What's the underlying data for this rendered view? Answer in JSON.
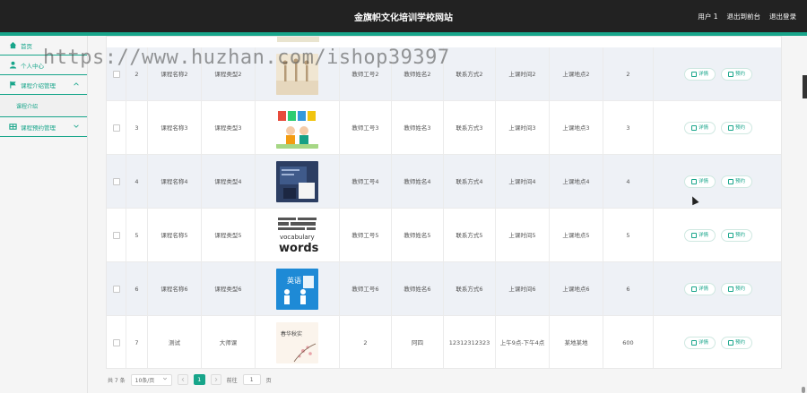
{
  "header": {
    "title": "金旗帜文化培训学校网站",
    "user": "用户 1",
    "back_admin": "退出到前台",
    "logout": "退出登录"
  },
  "sidebar": {
    "items": [
      {
        "label": "首页",
        "icon": "home-icon"
      },
      {
        "label": "个人中心",
        "icon": "user-icon"
      },
      {
        "label": "课程介绍管理",
        "icon": "flag-icon",
        "expandable": true
      },
      {
        "label": "课程介绍",
        "sub": true
      },
      {
        "label": "课程预约管理",
        "icon": "grid-icon",
        "expandable": true
      }
    ]
  },
  "table": {
    "rows": [
      {
        "no": "2",
        "name": "课程名称2",
        "type": "课程类型2",
        "image": "dance",
        "teacher_id": "教师工号2",
        "teacher_name": "教师姓名2",
        "contact": "联系方式2",
        "time": "上课时间2",
        "place": "上课地点2",
        "count": "2"
      },
      {
        "no": "3",
        "name": "课程名称3",
        "type": "课程类型3",
        "image": "abcd",
        "teacher_id": "教师工号3",
        "teacher_name": "教师姓名3",
        "contact": "联系方式3",
        "time": "上课时间3",
        "place": "上课地点3",
        "count": "3"
      },
      {
        "no": "4",
        "name": "课程名称4",
        "type": "课程类型4",
        "image": "class",
        "teacher_id": "教师工号4",
        "teacher_name": "教师姓名4",
        "contact": "联系方式4",
        "time": "上课时间4",
        "place": "上课地点4",
        "count": "4"
      },
      {
        "no": "5",
        "name": "课程名称5",
        "type": "课程类型5",
        "image": "words",
        "teacher_id": "教师工号5",
        "teacher_name": "教师姓名5",
        "contact": "联系方式5",
        "time": "上课时间5",
        "place": "上课地点5",
        "count": "5"
      },
      {
        "no": "6",
        "name": "课程名称6",
        "type": "课程类型6",
        "image": "english",
        "teacher_id": "教师工号6",
        "teacher_name": "教师姓名6",
        "contact": "联系方式6",
        "time": "上课时间6",
        "place": "上课地点6",
        "count": "6"
      },
      {
        "no": "7",
        "name": "测试",
        "type": "大师课",
        "image": "calligraphy",
        "teacher_id": "2",
        "teacher_name": "阿四",
        "contact": "12312312323",
        "time": "上午9点-下午4点",
        "place": "某地某地",
        "count": "600"
      }
    ],
    "detail_label": "详情",
    "book_label": "预约",
    "image_texts": {
      "words_text": "words",
      "words_small": "vocabulary",
      "english_cn": "英语",
      "calligraphy_text": "春华秋实"
    }
  },
  "pager": {
    "total": "共 7 条",
    "page_size": "10条/页",
    "current": "1",
    "goto_label": "前往",
    "goto_value": "1",
    "page_suffix": "页"
  },
  "watermark": "https://www.huzhan.com/ishop39397",
  "colors": {
    "accent": "#17a58a",
    "topbar": "#222222"
  }
}
